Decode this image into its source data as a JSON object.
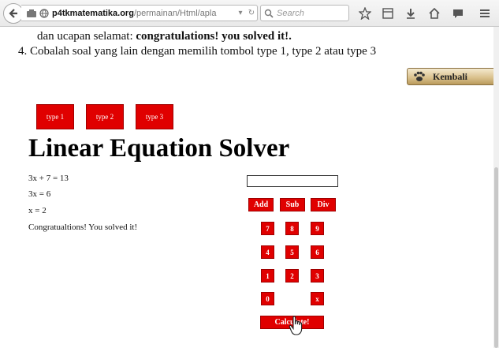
{
  "browser": {
    "url_host": "p4tkmatematika.org",
    "url_path": "/permainan/Html/apla",
    "search_placeholder": "Search"
  },
  "page": {
    "instruction_1_prefix": "dan ucapan selamat: ",
    "instruction_1_bold": "congratulations! you solved it!.",
    "instruction_2": "4. Cobalah soal yang lain dengan memilih tombol type 1, type 2 atau type 3",
    "back_button": "Kembali",
    "type_buttons": [
      "type 1",
      "type 2",
      "type 3"
    ],
    "title": "Linear Equation Solver",
    "work_lines": [
      "3x + 7 = 13",
      "3x = 6",
      "x = 2",
      "Congratualtions! You solved it!"
    ],
    "answer_value": "",
    "ops": [
      "Add",
      "Sub",
      "Div"
    ],
    "keys": [
      "7",
      "8",
      "9",
      "4",
      "5",
      "6",
      "1",
      "2",
      "3",
      "0",
      "x"
    ],
    "calculate": "Calculate!"
  },
  "colors": {
    "button_red": "#e00000",
    "back_button_gold": "#d8bf8a"
  }
}
